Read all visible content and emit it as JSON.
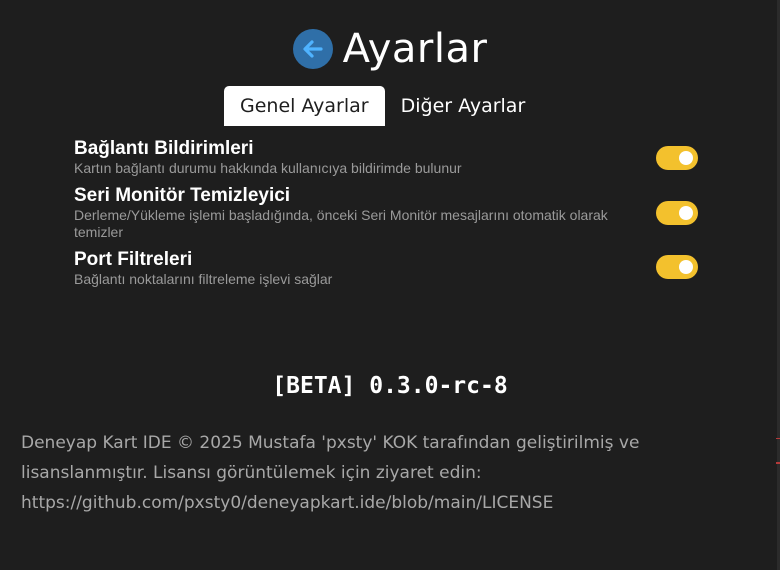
{
  "header": {
    "title": "Ayarlar",
    "back_icon": "arrow-left-icon",
    "back_color": "#2f6fa8"
  },
  "tabs": [
    {
      "label": "Genel Ayarlar",
      "active": true
    },
    {
      "label": "Diğer Ayarlar",
      "active": false
    }
  ],
  "settings": [
    {
      "title": "Bağlantı Bildirimleri",
      "description": "Kartın bağlantı durumu hakkında kullanıcıya bildirimde bulunur",
      "enabled": true
    },
    {
      "title": "Seri Monitör Temizleyici",
      "description": "Derleme/Yükleme işlemi başladığında, önceki Seri Monitör mesajlarını otomatik olarak temizler",
      "enabled": true
    },
    {
      "title": "Port Filtreleri",
      "description": "Bağlantı noktalarını filtreleme işlevi sağlar",
      "enabled": true
    }
  ],
  "version": "[BETA] 0.3.0-rc-8",
  "footer": {
    "line1": "Deneyap Kart IDE © 2025 Mustafa 'pxsty' KOK tarafından geliştirilmiş ve",
    "line2": "lisanslanmıştır. Lisansı görüntülemek için ziyaret edin:",
    "line3": "https://github.com/pxsty0/deneyapkart.ide/blob/main/LICENSE"
  },
  "colors": {
    "background": "#1e1e1e",
    "toggle_on": "#f3c12d",
    "description": "#9a9a9a"
  }
}
